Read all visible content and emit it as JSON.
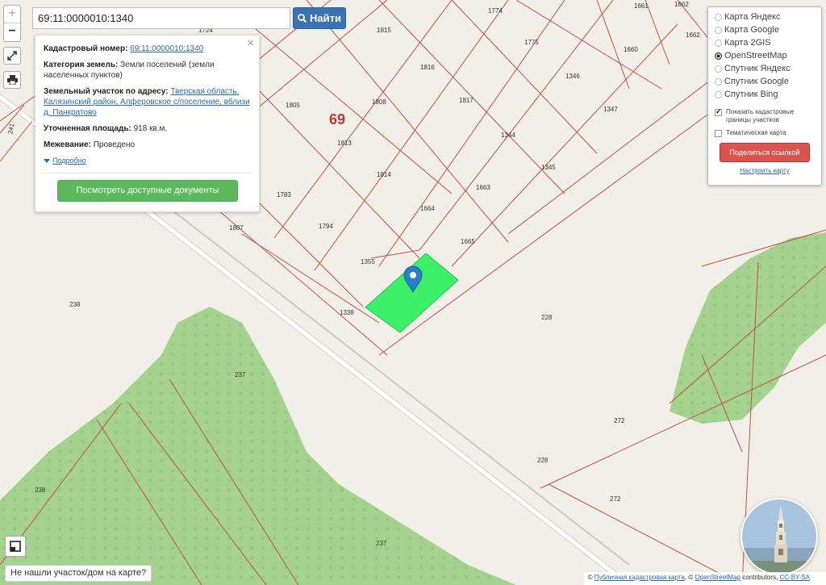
{
  "search": {
    "value": "69:11:0000010:1340",
    "button_label": "Найти"
  },
  "zoom": {
    "in": "+",
    "out": "−"
  },
  "info": {
    "cadastral_label": "Кадастровый номер:",
    "cadastral_value": "69:11:0000010:1340",
    "category_label": "Категория земель:",
    "category_value": "Земли поселений (земли населенных пунктов)",
    "address_label": "Земельный участок по адресу:",
    "address_value": "Тверская область, Калязинский район, Алферовское с/поселение, вблизи д. Панкратово",
    "area_label": "Уточненная площадь:",
    "area_value": "918 кв.м.",
    "survey_label": "Межевание:",
    "survey_value": "Проведено",
    "more_label": "Подробно",
    "docs_button": "Посмотреть доступные документы",
    "close": "×"
  },
  "layers": {
    "options": [
      {
        "label": "Карта Яндекс",
        "selected": false
      },
      {
        "label": "Карта Google",
        "selected": false
      },
      {
        "label": "Карта 2GIS",
        "selected": false
      },
      {
        "label": "OpenStreetMap",
        "selected": true
      },
      {
        "label": "Спутник Яндекс",
        "selected": false
      },
      {
        "label": "Спутник Google",
        "selected": false
      },
      {
        "label": "Спутник Bing",
        "selected": false
      }
    ],
    "show_borders": "Показать кадастровые границы участков",
    "show_borders_checked": true,
    "thematic": "Тематическая карта",
    "thematic_checked": false,
    "share_button": "Поделиться ссылкой",
    "setup_link": "Настроить карту"
  },
  "region_label": "69",
  "parcel_labels": [
    "1774",
    "1661",
    "1662",
    "1815",
    "1775",
    "1660",
    "1662",
    "1724",
    "1816",
    "1346",
    "1805",
    "1808",
    "1817",
    "1347",
    "1344",
    "1813",
    "1814",
    "1345",
    "1663",
    "1783",
    "1664",
    "1794",
    "1665",
    "1807",
    "1355",
    "1338",
    "228",
    "238",
    "237",
    "272",
    "228",
    "272",
    "238",
    "237",
    "241"
  ],
  "not_found": "Не нашли участок/дом на карте?",
  "attribution": {
    "prefix": "©",
    "pkk": "Публичная кадастровая карта",
    "middle": ", ©",
    "osm": "OpenStreetMap",
    "suffix": "contributors,",
    "license": "CC-BY-SA"
  },
  "colors": {
    "parcel_highlight": "#3cf06a",
    "forest": "#9fce8a",
    "border": "#c0504d",
    "search_button": "#3a72b5",
    "docs_button": "#5cb85c",
    "share_button": "#d9534f",
    "marker": "#2b7ccb"
  }
}
